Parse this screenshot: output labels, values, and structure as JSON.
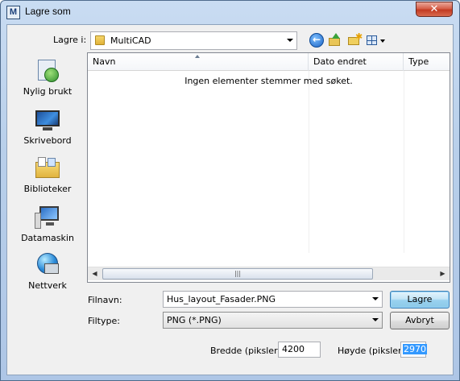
{
  "window": {
    "title": "Lagre som",
    "app_icon_letter": "M"
  },
  "toolbar": {
    "lookin_label": "Lagre i:",
    "lookin_value": "MultiCAD",
    "icons": [
      "back-icon",
      "up-folder-icon",
      "new-folder-icon",
      "views-menu-icon"
    ]
  },
  "places": [
    {
      "label": "Nylig brukt",
      "icon": "recent-places-icon"
    },
    {
      "label": "Skrivebord",
      "icon": "desktop-icon"
    },
    {
      "label": "Biblioteker",
      "icon": "libraries-icon"
    },
    {
      "label": "Datamaskin",
      "icon": "computer-icon"
    },
    {
      "label": "Nettverk",
      "icon": "network-icon"
    }
  ],
  "filelist": {
    "columns": [
      "Navn",
      "Dato endret",
      "Type"
    ],
    "empty_message": "Ingen elementer stemmer med søket."
  },
  "form": {
    "filename_label": "Filnavn:",
    "filename_value": "Hus_layout_Fasader.PNG",
    "filetype_label": "Filtype:",
    "filetype_value": "PNG (*.PNG)",
    "save_label": "Lagre",
    "cancel_label": "Avbryt",
    "width_label": "Bredde (piksler)",
    "width_value": "4200",
    "height_label": "Høyde (piksler)",
    "height_value": "2970"
  },
  "colors": {
    "selection": "#3399ff",
    "close_button": "#c23a22"
  }
}
